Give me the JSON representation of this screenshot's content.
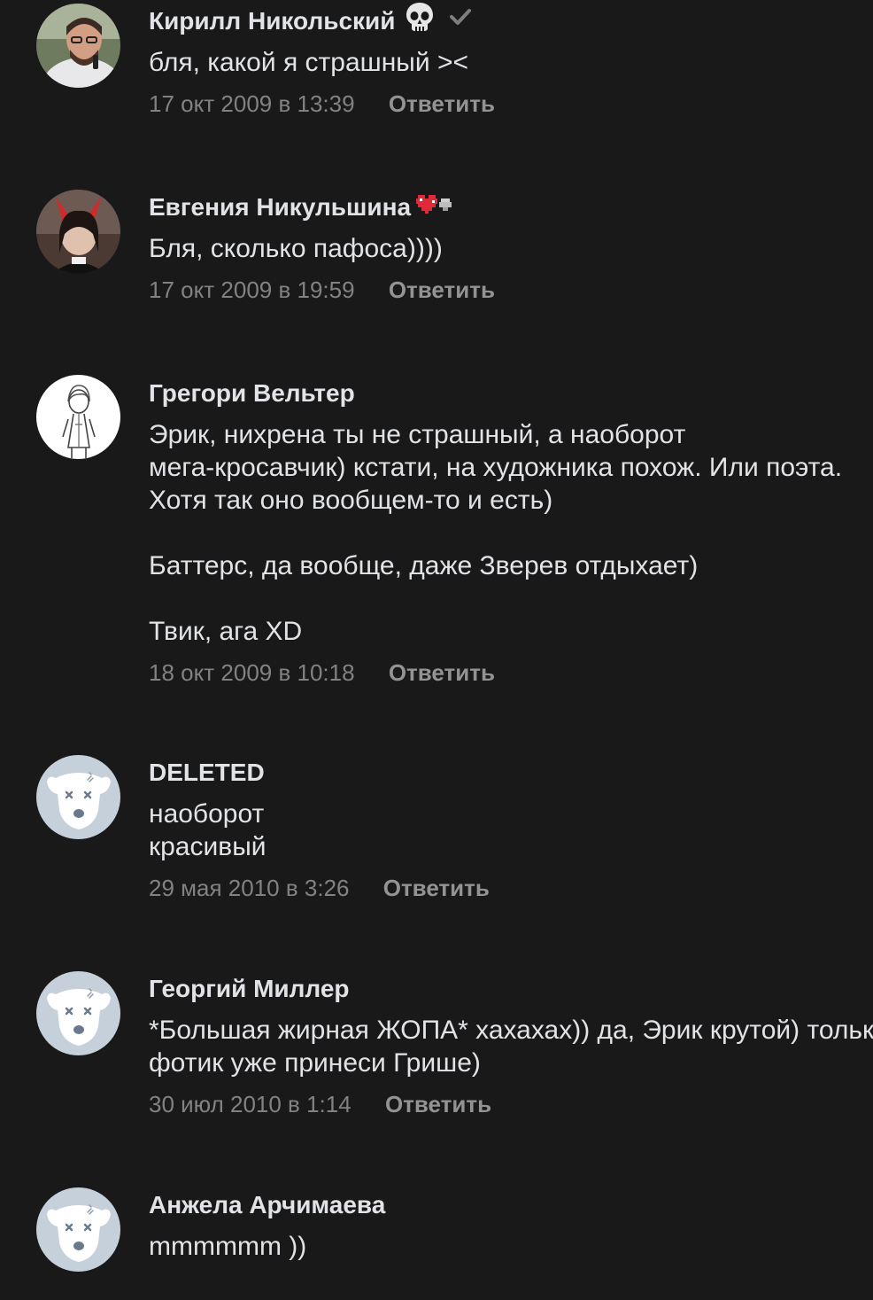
{
  "reply_label": "Ответить",
  "comments": [
    {
      "author": "Кирилл Никольский",
      "badge_icon": "skull-emoji",
      "text": "бля, какой я страшный ><",
      "date": "17 окт 2009 в 13:39"
    },
    {
      "author": "Евгения Никульшина",
      "badge_icon": "pixel-heart-emoji",
      "text": "Бля, сколько пафоса))))",
      "date": "17 окт 2009 в 19:59"
    },
    {
      "author": "Грегори Вельтер",
      "text": "Эрик, нихрена ты не страшный, а наоборот\nмега-кросавчик) кстати, на художника похож. Или поэта.\nХотя так оно вообщем-то и есть)\n\nБаттерс, да вообще, даже Зверев отдыхает)\n\nТвик, ага XD",
      "date": "18 окт 2009 в 10:18"
    },
    {
      "author": "DELETED",
      "avatar_icon": "deleted-dog-avatar",
      "text": "наоборот\nкрасивый",
      "date": "29 мая 2010 в 3:26"
    },
    {
      "author": "Георгий Миллер",
      "avatar_icon": "deleted-dog-avatar",
      "text": "*Большая жирная ЖОПА* хахахах)) да, Эрик крутой) только\nфотик уже принеси Грише)",
      "date": "30 июл 2010 в 1:14"
    },
    {
      "author": "Анжела Арчимаева",
      "avatar_icon": "deleted-dog-avatar",
      "text": "mmmmmm ))"
    }
  ],
  "colors": {
    "background": "#19191a",
    "text": "#e1e3e6",
    "secondary": "#828282",
    "deleted_avatar_bg": "#c5d0db"
  }
}
